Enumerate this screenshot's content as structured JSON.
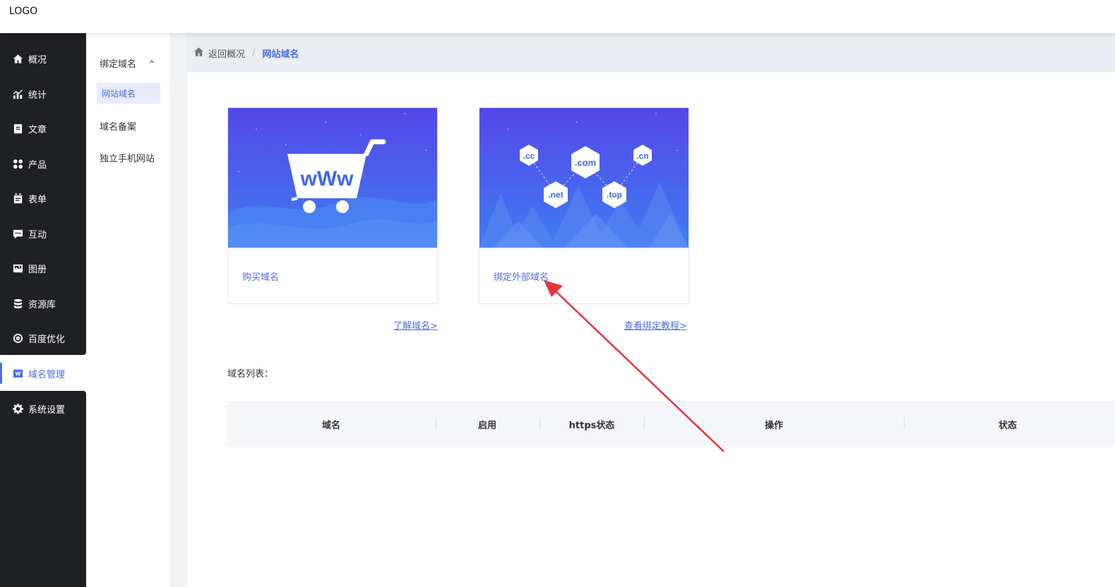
{
  "header": {
    "logo": "LOGO"
  },
  "sidebar": {
    "items": [
      {
        "label": "概况",
        "icon": "home-icon"
      },
      {
        "label": "统计",
        "icon": "chart-icon"
      },
      {
        "label": "文章",
        "icon": "article-icon"
      },
      {
        "label": "产品",
        "icon": "grid-icon"
      },
      {
        "label": "表单",
        "icon": "form-icon"
      },
      {
        "label": "互动",
        "icon": "chat-icon"
      },
      {
        "label": "图册",
        "icon": "album-icon"
      },
      {
        "label": "资源库",
        "icon": "database-icon"
      },
      {
        "label": "百度优化",
        "icon": "seo-icon"
      },
      {
        "label": "域名管理",
        "icon": "domain-icon",
        "active": true
      },
      {
        "label": "系统设置",
        "icon": "gear-icon"
      }
    ]
  },
  "subnav": {
    "group": "绑定域名",
    "items": [
      {
        "label": "网站域名",
        "active": true
      },
      {
        "label": "域名备案"
      },
      {
        "label": "独立手机网站"
      }
    ]
  },
  "breadcrumb": {
    "back": "返回概况",
    "separator": "/",
    "current": "网站域名"
  },
  "cards": [
    {
      "label": "购买域名",
      "link": "了解域名>"
    },
    {
      "label": "绑定外部域名",
      "link": "查看绑定教程>"
    }
  ],
  "domain_tags": [
    ".cc",
    ".com",
    ".cn",
    ".net",
    ".top"
  ],
  "cart_text": "wWw",
  "list": {
    "title": "域名列表：",
    "columns": [
      "域名",
      "启用",
      "https状态",
      "操作",
      "状态"
    ]
  },
  "colors": {
    "accent": "#4a6ee0",
    "sidebar_bg": "#1f2024",
    "annotation_arrow": "#e8343a"
  }
}
